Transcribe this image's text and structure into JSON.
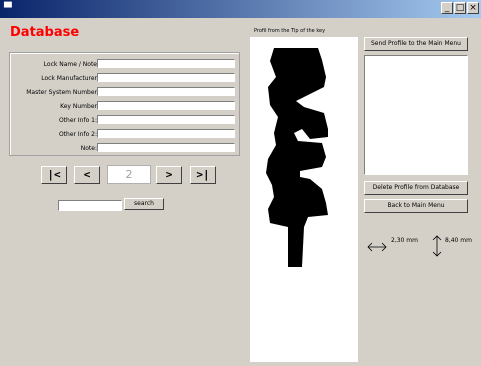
{
  "window": {
    "title": "",
    "min_label": "_",
    "max_label": "□",
    "close_label": "×"
  },
  "header": {
    "title": "Database"
  },
  "fields": [
    {
      "label": "Lock Name / Note",
      "value": ""
    },
    {
      "label": "Lock Manufacturer",
      "value": ""
    },
    {
      "label": "Master System Number",
      "value": ""
    },
    {
      "label": "Key Number",
      "value": ""
    },
    {
      "label": "Other Info 1:",
      "value": ""
    },
    {
      "label": "Other Info 2:",
      "value": ""
    },
    {
      "label": "Note:",
      "value": ""
    }
  ],
  "navigation": {
    "first_label": "|<",
    "prev_label": "<",
    "counter_value": "2",
    "next_label": ">",
    "last_label": ">|"
  },
  "search": {
    "value": "",
    "button_label": "search"
  },
  "profile": {
    "label": "Profil from the Tip of the key"
  },
  "right_panel": {
    "send_button": "Send Profile to the Main Menu",
    "delete_button": "Delete Profile from Database",
    "back_button": "Back to Main Menu"
  },
  "dimensions": {
    "width": "2,30 mm",
    "height": "8,40 mm"
  }
}
